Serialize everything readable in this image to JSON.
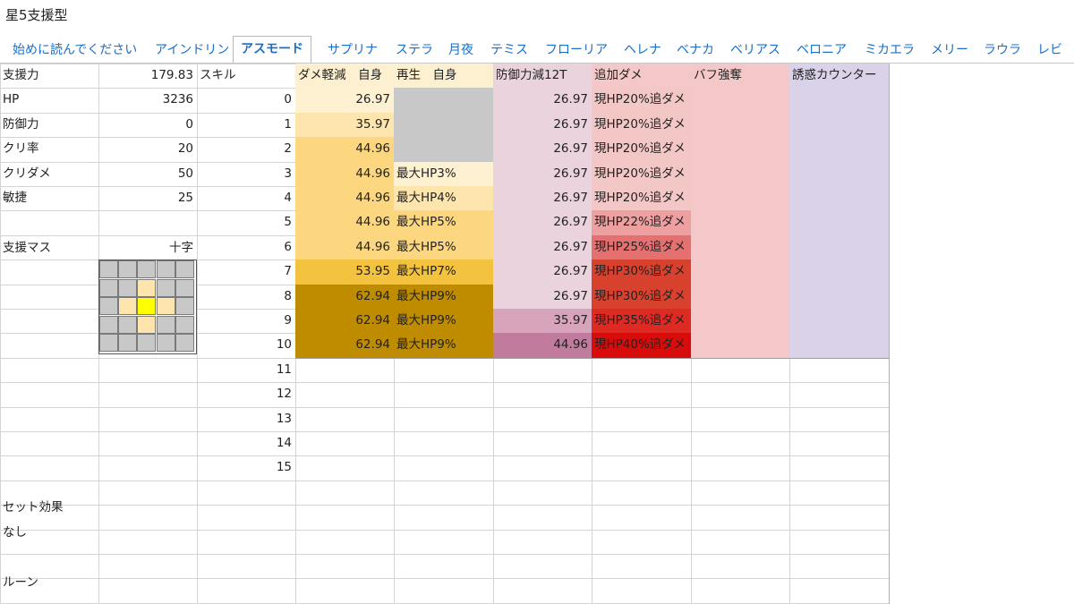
{
  "doc_title": "星5支援型",
  "tabs": [
    {
      "label": "始めに読んでください",
      "active": false
    },
    {
      "label": "アインドリン",
      "active": false
    },
    {
      "label": "アスモード",
      "active": true
    },
    {
      "label": "サプリナ",
      "active": false
    },
    {
      "label": "ステラ",
      "active": false
    },
    {
      "label": "月夜",
      "active": false
    },
    {
      "label": "テミス",
      "active": false
    },
    {
      "label": "フローリア",
      "active": false
    },
    {
      "label": "ヘレナ",
      "active": false
    },
    {
      "label": "ベナカ",
      "active": false
    },
    {
      "label": "ベリアス",
      "active": false
    },
    {
      "label": "ベロニア",
      "active": false
    },
    {
      "label": "ミカエラ",
      "active": false
    },
    {
      "label": "メリー",
      "active": false
    },
    {
      "label": "ラウラ",
      "active": false
    },
    {
      "label": "レビ",
      "active": false
    }
  ],
  "stats": [
    {
      "label": "支援力",
      "value": "179.83"
    },
    {
      "label": "HP",
      "value": "3236"
    },
    {
      "label": "防御力",
      "value": "0"
    },
    {
      "label": "クリ率",
      "value": "20"
    },
    {
      "label": "クリダメ",
      "value": "50"
    },
    {
      "label": "敏捷",
      "value": "25"
    },
    {
      "label": "",
      "value": ""
    },
    {
      "label": "支援マス",
      "value": "十字"
    }
  ],
  "left_lower": [
    "セット効果",
    "なし",
    "",
    "ルーン"
  ],
  "skill_header": "スキル",
  "columns": [
    "ダメ軽減　自身",
    "再生　自身",
    "防御力減12T",
    "追加ダメ",
    "バフ強奪",
    "誘惑カウンター"
  ],
  "levels": [
    "0",
    "1",
    "2",
    "3",
    "4",
    "5",
    "6",
    "7",
    "8",
    "9",
    "10",
    "11",
    "12",
    "13",
    "14",
    "15"
  ],
  "dmg_reduction": [
    "26.97",
    "35.97",
    "44.96",
    "44.96",
    "44.96",
    "44.96",
    "44.96",
    "53.95",
    "62.94",
    "62.94",
    "62.94"
  ],
  "regen": [
    "",
    "",
    "",
    "最大HP3%",
    "最大HP4%",
    "最大HP5%",
    "最大HP5%",
    "最大HP7%",
    "最大HP9%",
    "最大HP9%",
    "最大HP9%"
  ],
  "def_down": [
    "26.97",
    "26.97",
    "26.97",
    "26.97",
    "26.97",
    "26.97",
    "26.97",
    "26.97",
    "26.97",
    "35.97",
    "44.96"
  ],
  "extra_dmg": [
    "現HP20%追ダメ",
    "現HP20%追ダメ",
    "現HP20%追ダメ",
    "現HP20%追ダメ",
    "現HP20%追ダメ",
    "現HP22%追ダメ",
    "現HP25%追ダメ",
    "現HP30%追ダメ",
    "現HP30%追ダメ",
    "現HP35%追ダメ",
    "現HP40%追ダメ"
  ],
  "colors": {
    "dmg": [
      "#fdf1d2",
      "#fde5ad",
      "#fcd77f",
      "#fcd77f",
      "#fcd77f",
      "#fcd77f",
      "#fcd77f",
      "#f3c23f",
      "#bf8c00",
      "#bf8c00",
      "#bf8c00"
    ],
    "regen": [
      "#c8c8c8",
      "#c8c8c8",
      "#c8c8c8",
      "#fdf1d2",
      "#fde5ad",
      "#fcd77f",
      "#fcd77f",
      "#f3c23f",
      "#bf8c00",
      "#bf8c00",
      "#bf8c00"
    ],
    "def": [
      "#ead3dc",
      "#ead3dc",
      "#ead3dc",
      "#ead3dc",
      "#ead3dc",
      "#ead3dc",
      "#ead3dc",
      "#ead3dc",
      "#ead3dc",
      "#d8a4bc",
      "#c17b9d"
    ],
    "extra": [
      "#f4c7c7",
      "#f4c7c7",
      "#f4c7c7",
      "#f4c7c7",
      "#f4c7c7",
      "#ee9f9f",
      "#e47070",
      "#d9412f",
      "#d9412f",
      "#dd2b23",
      "#d90c0c"
    ],
    "buff": "#f4c8c8",
    "charm": "#d9d2e9",
    "hdr": [
      "#fdf0d0",
      "#fdf0d0",
      "#ead3dc",
      "#f4c8c8",
      "#f4c8c8",
      "#d9d2e9"
    ],
    "cross_center": "#ffff00",
    "cross_arm": "#fde5ad",
    "cross_bg": "#c8c8c8"
  }
}
